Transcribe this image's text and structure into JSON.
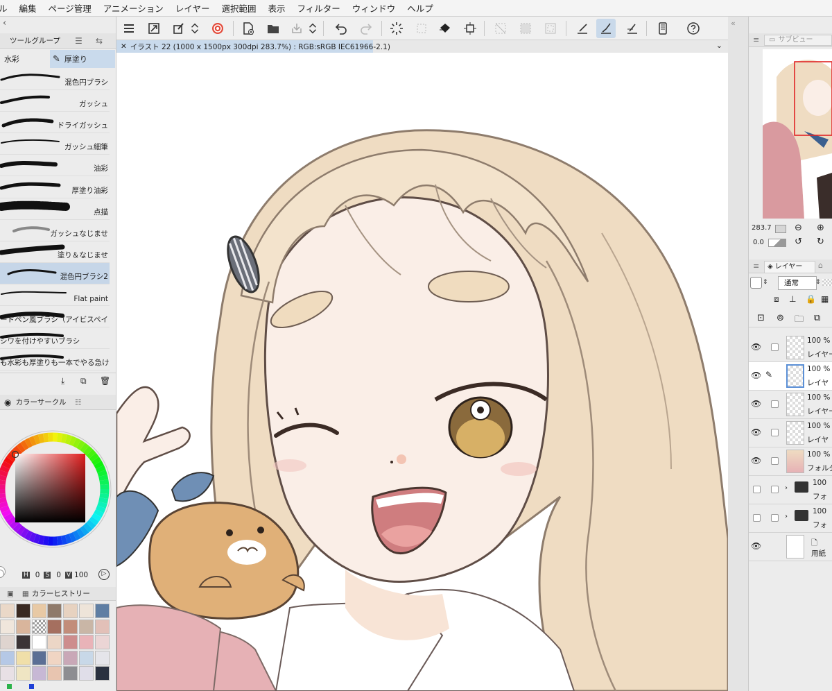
{
  "menu": [
    "ル",
    "編集",
    "ページ管理",
    "アニメーション",
    "レイヤー",
    "選択範囲",
    "表示",
    "フィルター",
    "ウィンドウ",
    "ヘルプ"
  ],
  "doc_tab": {
    "title": "イラスト 22 (1000 x 1500px 300dpi 283.7%) : RGB:sRGB IEC61966-2.1)"
  },
  "tool_panel": {
    "title": "ツールグループ",
    "subtabs": [
      "水彩",
      "厚塗り"
    ],
    "brushes": [
      "混色円ブラシ",
      "ガッシュ",
      "ドライガッシュ",
      "ガッシュ細筆",
      "油彩",
      "厚塗り油彩",
      "点描",
      "ガッシュなじませ",
      "塗り＆なじませ",
      "混色円ブラシ2",
      "Flat paint",
      "ードペン風ブラシ（アイビスペイ",
      "シワを付けやすいブラシ",
      "も水彩も厚塗りも一本でやる急け"
    ]
  },
  "color_panel": {
    "title": "カラーサークル",
    "hsv": {
      "h_label": "H",
      "h": "0",
      "s_label": "S",
      "s": "0",
      "v_label": "V",
      "v": "100"
    }
  },
  "history_panel": {
    "title": "カラーヒストリー",
    "swatches": [
      "#ead8c8",
      "#3a2a22",
      "#e8c9a5",
      "#8f7a6a",
      "#e7d2c0",
      "#eee4d9",
      "#5f7ea3",
      "#f0e6dc",
      "#d9b59c",
      "#cfc5bb",
      "#a56f5f",
      "#c28d7a",
      "#c9b6a6",
      "#e2c0b8",
      "#dfd4cf",
      "#3b3436",
      "#ffffff",
      "#ecd6c6",
      "#cd8d8d",
      "#e9b3b8",
      "#ebd5d5",
      "#b5c8e6",
      "#f0dfa9",
      "#5b6f95",
      "#f0d5c3",
      "#c9a8b7",
      "#c8d8e8",
      "#e5e5ea",
      "#e8e0e5",
      "#efe5c3",
      "#c7b8d5",
      "#e8c5b0",
      "#8d8d91",
      "#e0dee9",
      "#2a3140"
    ]
  },
  "navigator": {
    "title": "サブビュー",
    "zoom": "283.7",
    "rotate": "0.0"
  },
  "layer_panel": {
    "title": "レイヤー",
    "blend_mode": "通常",
    "layers": [
      {
        "pct": "100 %",
        "name": "レイヤー"
      },
      {
        "pct": "100 %",
        "name": "レイヤ"
      },
      {
        "pct": "100 %",
        "name": "レイヤー"
      },
      {
        "pct": "100 %",
        "name": "レイヤ"
      },
      {
        "pct": "100 %",
        "name": "フォルダ"
      },
      {
        "pct": "100",
        "name": "フォ"
      },
      {
        "pct": "100",
        "name": "フォ"
      },
      {
        "pct": "",
        "name": "用紙"
      }
    ]
  },
  "colors": {
    "accent_selected": "#c9daec",
    "hair": "#efdcc2",
    "skin": "#faeee7"
  }
}
